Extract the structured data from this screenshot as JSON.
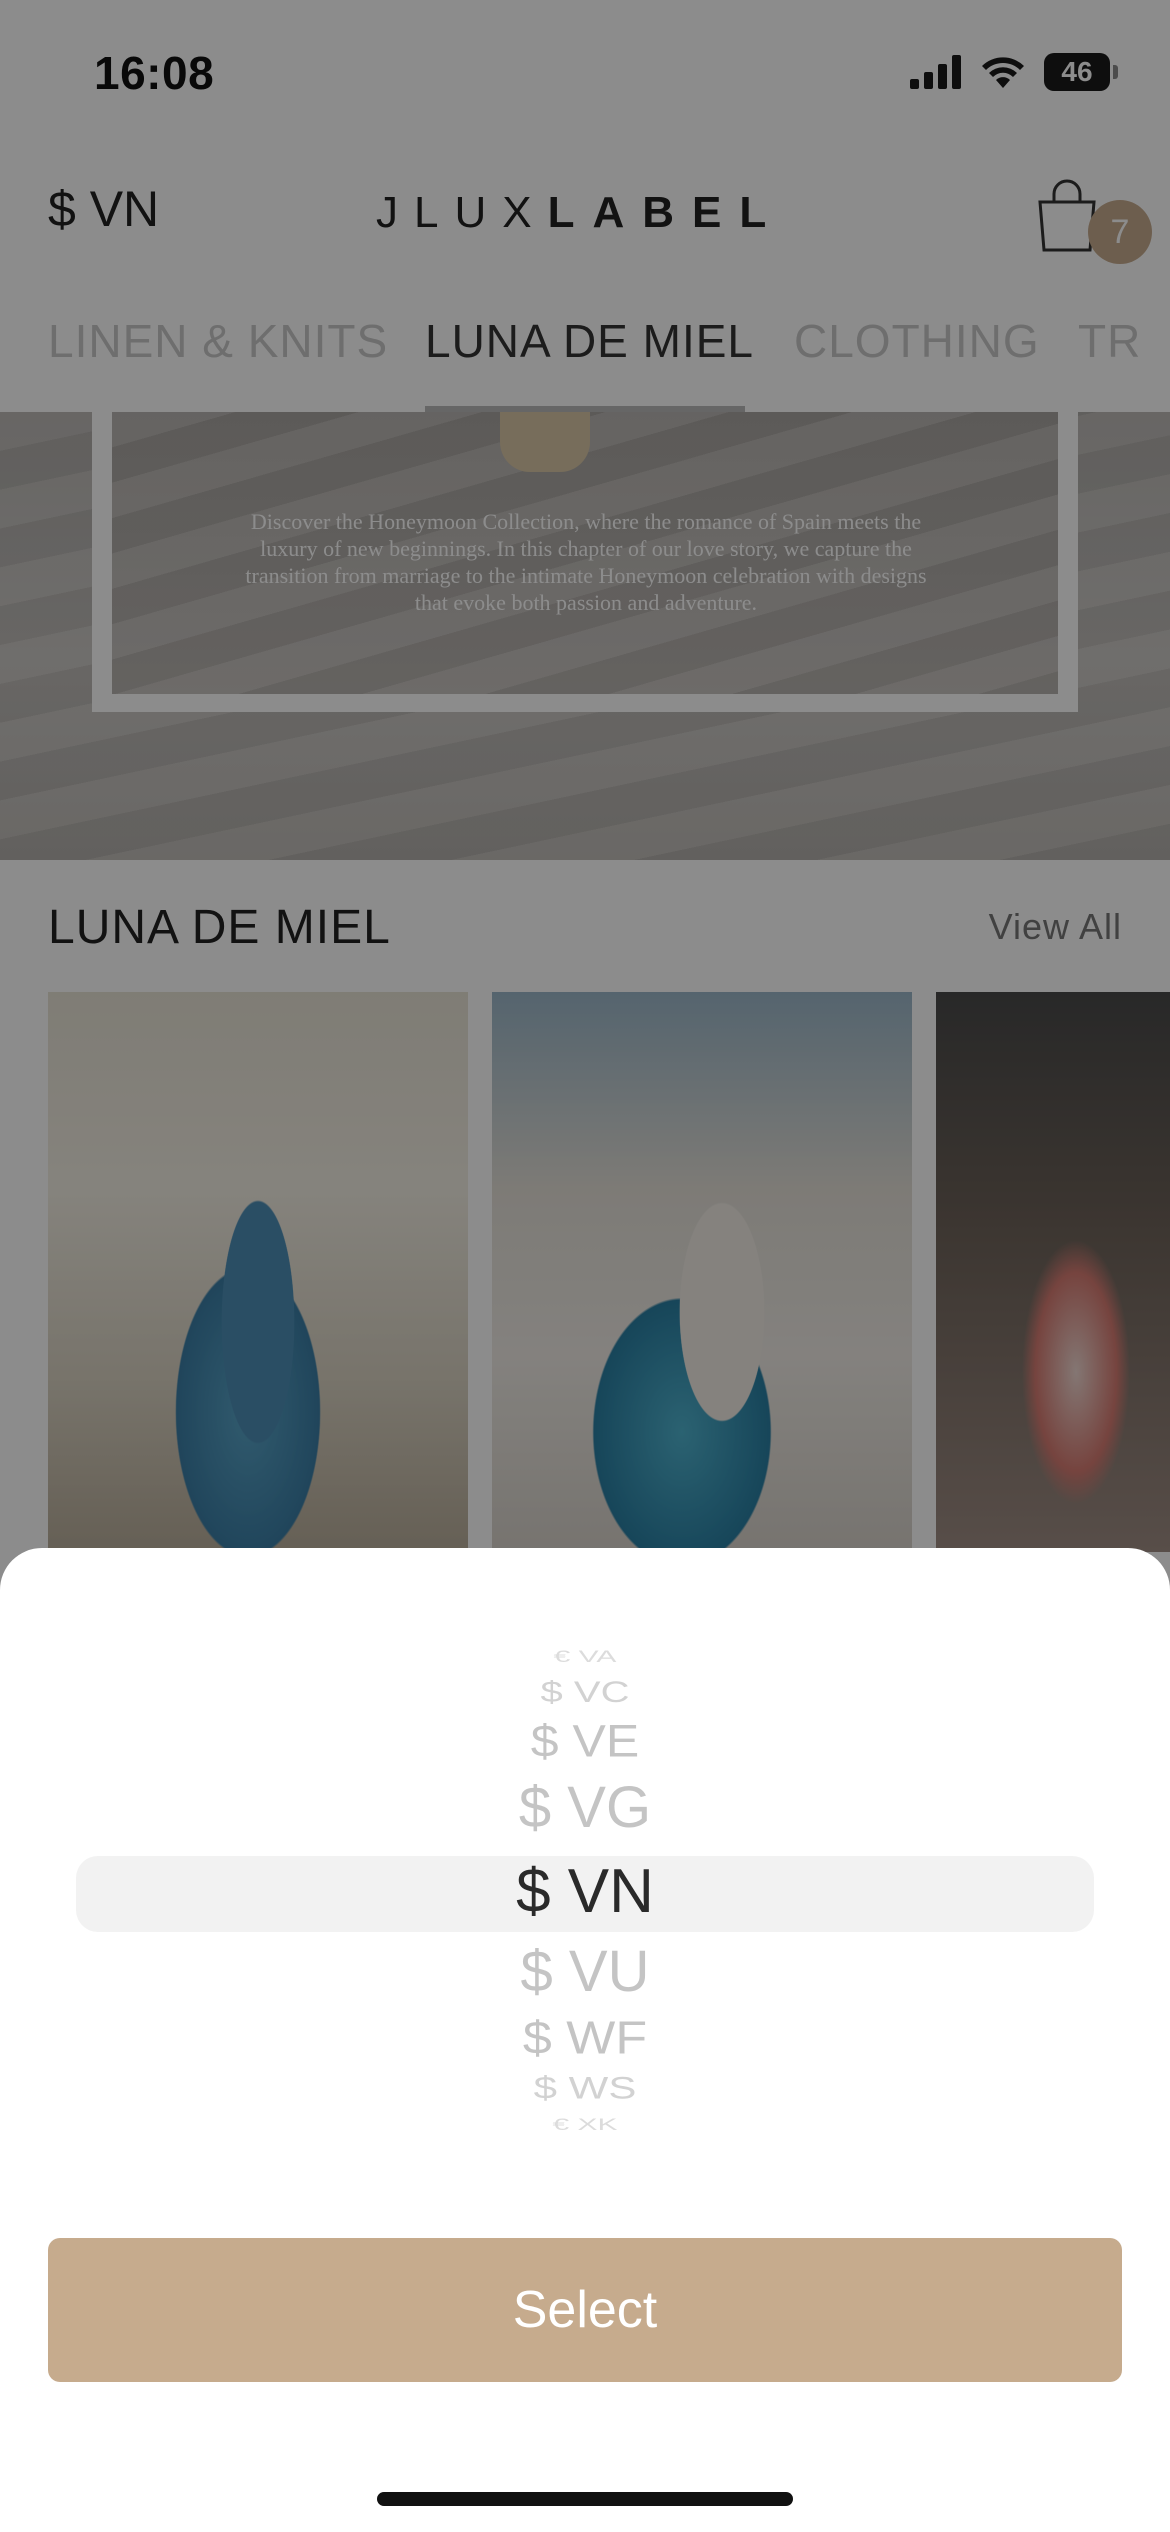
{
  "status_bar": {
    "time": "16:08",
    "battery": "46"
  },
  "header": {
    "currency": "$ VN",
    "logo_thin": "JLUX",
    "logo_bold": "LABEL",
    "cart_count": "7"
  },
  "tabs": [
    "LINEN & KNITS",
    "LUNA DE MIEL",
    "CLOTHING",
    "TR"
  ],
  "hero": {
    "text": "Discover the Honeymoon Collection, where the romance of Spain meets the luxury of new beginnings. In this chapter of our love story, we capture the transition from marriage to the intimate Honeymoon celebration with designs that evoke both passion and adventure."
  },
  "section": {
    "title": "LUNA DE MIEL",
    "view_all": "View All"
  },
  "picker": {
    "options": [
      "€ VA",
      "$ VC",
      "$ VE",
      "$ VG",
      "$ VN",
      "$ VU",
      "$ WF",
      "$ WS",
      "€ XK"
    ],
    "selected": "$ VN"
  },
  "select_button": {
    "label": "Select"
  }
}
